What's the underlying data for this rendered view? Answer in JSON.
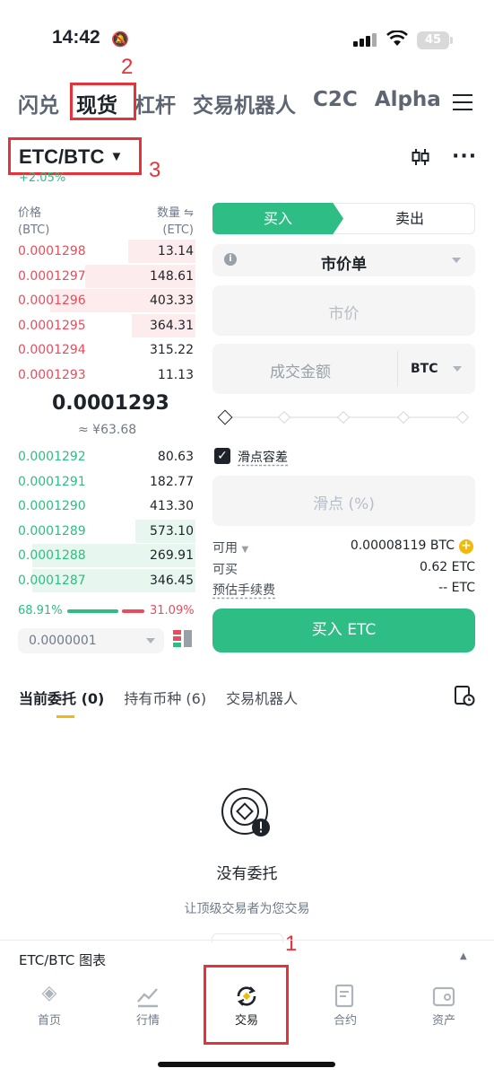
{
  "status": {
    "time": "14:42",
    "battery": "45"
  },
  "top_tabs": [
    "闪兑",
    "现货",
    "杠杆",
    "交易机器人",
    "C2C",
    "Alpha"
  ],
  "annotations": {
    "n1": "1",
    "n2": "2",
    "n3": "3"
  },
  "pair": {
    "name": "ETC/BTC",
    "change": "+2.05%"
  },
  "orderbook": {
    "price_header": "价格",
    "price_unit": "(BTC)",
    "qty_header": "数量 ⇋",
    "qty_unit": "(ETC)",
    "asks": [
      {
        "price": "0.0001298",
        "qty": "13.14",
        "depth": 0.38
      },
      {
        "price": "0.0001297",
        "qty": "148.61",
        "depth": 0.62
      },
      {
        "price": "0.0001296",
        "qty": "403.33",
        "depth": 0.82
      },
      {
        "price": "0.0001295",
        "qty": "364.31",
        "depth": 0.36
      },
      {
        "price": "0.0001294",
        "qty": "315.22",
        "depth": 0.0
      },
      {
        "price": "0.0001293",
        "qty": "11.13",
        "depth": 0.0
      }
    ],
    "last_price": "0.0001293",
    "fiat": "≈ ¥63.68",
    "bids": [
      {
        "price": "0.0001292",
        "qty": "80.63",
        "depth": 0.0
      },
      {
        "price": "0.0001291",
        "qty": "182.77",
        "depth": 0.0
      },
      {
        "price": "0.0001290",
        "qty": "413.30",
        "depth": 0.0
      },
      {
        "price": "0.0001289",
        "qty": "573.10",
        "depth": 0.34
      },
      {
        "price": "0.0001288",
        "qty": "269.91",
        "depth": 0.92
      },
      {
        "price": "0.0001287",
        "qty": "346.45",
        "depth": 0.92
      }
    ],
    "buy_pct": "68.91%",
    "sell_pct": "31.09%",
    "buy_ratio": 0.6891,
    "precision": "0.0000001"
  },
  "form": {
    "buy": "买入",
    "sell": "卖出",
    "order_type": "市价单",
    "price_placeholder": "市价",
    "amount_placeholder": "成交金额",
    "amount_unit": "BTC",
    "slippage_check": "滑点容差",
    "slippage_placeholder": "滑点 (%)",
    "available_label": "可用",
    "available_value": "0.00008119 BTC",
    "can_buy_label": "可买",
    "can_buy_value": "0.62 ETC",
    "fee_label": "预估手续费",
    "fee_value": "-- ETC",
    "submit": "买入 ETC"
  },
  "orders_tabs": [
    "当前委托 (0)",
    "持有币种 (6)",
    "交易机器人"
  ],
  "empty": {
    "title": "没有委托",
    "subtitle": "让顶级交易者为您交易"
  },
  "chart_bar": "ETC/BTC 图表",
  "nav": [
    "首页",
    "行情",
    "交易",
    "合约",
    "资产"
  ],
  "colors": {
    "green": "#2ebd85",
    "red": "#e44e5d",
    "annotation_red": "#e5333b"
  }
}
